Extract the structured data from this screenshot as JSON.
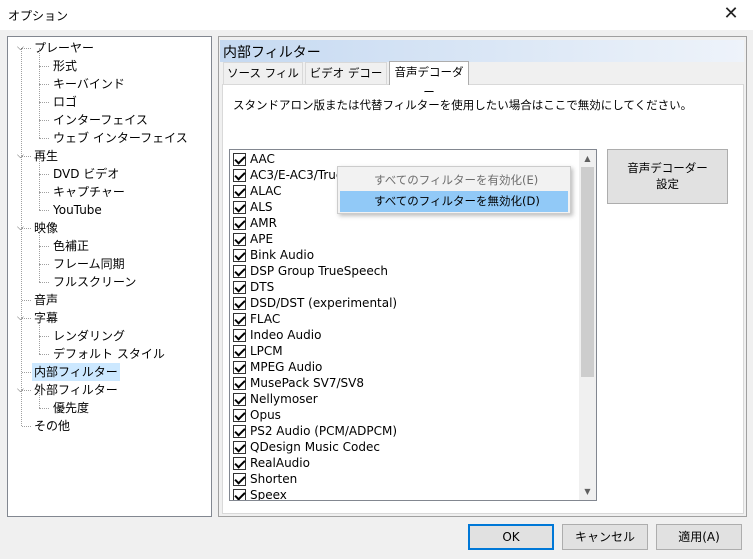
{
  "window": {
    "title": "オプション"
  },
  "tree": {
    "items": [
      {
        "label": "プレーヤー",
        "level": 0,
        "expander": "−"
      },
      {
        "label": "形式",
        "level": 1
      },
      {
        "label": "キーバインド",
        "level": 1
      },
      {
        "label": "ロゴ",
        "level": 1
      },
      {
        "label": "インターフェイス",
        "level": 1
      },
      {
        "label": "ウェブ インターフェイス",
        "level": 1
      },
      {
        "label": "再生",
        "level": 0,
        "expander": "−"
      },
      {
        "label": "DVD ビデオ",
        "level": 1
      },
      {
        "label": "キャプチャー",
        "level": 1
      },
      {
        "label": "YouTube",
        "level": 1
      },
      {
        "label": "映像",
        "level": 0,
        "expander": "−"
      },
      {
        "label": "色補正",
        "level": 1
      },
      {
        "label": "フレーム同期",
        "level": 1
      },
      {
        "label": "フルスクリーン",
        "level": 1
      },
      {
        "label": "音声",
        "level": 0
      },
      {
        "label": "字幕",
        "level": 0,
        "expander": "−"
      },
      {
        "label": "レンダリング",
        "level": 1
      },
      {
        "label": "デフォルト スタイル",
        "level": 1
      },
      {
        "label": "内部フィルター",
        "level": 0,
        "selected": true
      },
      {
        "label": "外部フィルター",
        "level": 0,
        "expander": "−"
      },
      {
        "label": "優先度",
        "level": 1
      },
      {
        "label": "その他",
        "level": 0
      }
    ]
  },
  "panel": {
    "header": "内部フィルター",
    "tabs": [
      "ソース フィルター",
      "ビデオ デコーダー",
      "音声デコーダー"
    ],
    "active_tab": 2,
    "instruction": "スタンドアロン版または代替フィルターを使用したい場合はここで無効にしてください。",
    "decoder_button": [
      "音声デコーダー",
      "設定"
    ],
    "filters": [
      {
        "label": "AAC",
        "checked": true
      },
      {
        "label": "AC3/E-AC3/TrueHD/MLP",
        "checked": true
      },
      {
        "label": "ALAC",
        "checked": true
      },
      {
        "label": "ALS",
        "checked": true
      },
      {
        "label": "AMR",
        "checked": true
      },
      {
        "label": "APE",
        "checked": true
      },
      {
        "label": "Bink Audio",
        "checked": true
      },
      {
        "label": "DSP Group TrueSpeech",
        "checked": true
      },
      {
        "label": "DTS",
        "checked": true
      },
      {
        "label": "DSD/DST (experimental)",
        "checked": true
      },
      {
        "label": "FLAC",
        "checked": true
      },
      {
        "label": "Indeo Audio",
        "checked": true
      },
      {
        "label": "LPCM",
        "checked": true
      },
      {
        "label": "MPEG Audio",
        "checked": true
      },
      {
        "label": "MusePack SV7/SV8",
        "checked": true
      },
      {
        "label": "Nellymoser",
        "checked": true
      },
      {
        "label": "Opus",
        "checked": true
      },
      {
        "label": "PS2 Audio (PCM/ADPCM)",
        "checked": true
      },
      {
        "label": "QDesign Music Codec",
        "checked": true
      },
      {
        "label": "RealAudio",
        "checked": true
      },
      {
        "label": "Shorten",
        "checked": true
      },
      {
        "label": "Speex",
        "checked": true
      }
    ]
  },
  "context_menu": {
    "items": [
      {
        "label": "すべてのフィルターを有効化(E)",
        "disabled": true
      },
      {
        "label": "すべてのフィルターを無効化(D)",
        "hover": true
      }
    ]
  },
  "buttons": {
    "ok": "OK",
    "cancel": "キャンセル",
    "apply": "適用(A)"
  },
  "colors": {
    "selection": "#cce8ff",
    "menu_hover": "#91c9f7",
    "accent": "#0078d7"
  }
}
